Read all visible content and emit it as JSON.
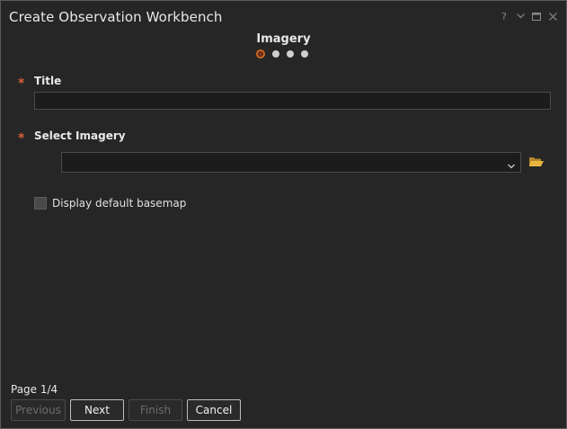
{
  "window": {
    "title": "Create Observation Workbench",
    "controls": {
      "help": "?",
      "accent": "#8a8a8a"
    }
  },
  "wizard": {
    "step_title": "Imagery",
    "current_step": 1,
    "total_steps": 4,
    "page_indicator": "Page 1/4",
    "active_dot_color": "#d2691e"
  },
  "form": {
    "title_field": {
      "required_mark": "*",
      "label": "Title",
      "value": ""
    },
    "imagery_field": {
      "required_mark": "*",
      "label": "Select Imagery",
      "value": ""
    },
    "basemap_checkbox": {
      "label": "Display default basemap",
      "checked": false
    }
  },
  "buttons": {
    "previous": "Previous",
    "next": "Next",
    "finish": "Finish",
    "cancel": "Cancel"
  },
  "colors": {
    "background": "#262626",
    "required": "#d8603a",
    "folder_icon": "#e0b030"
  }
}
